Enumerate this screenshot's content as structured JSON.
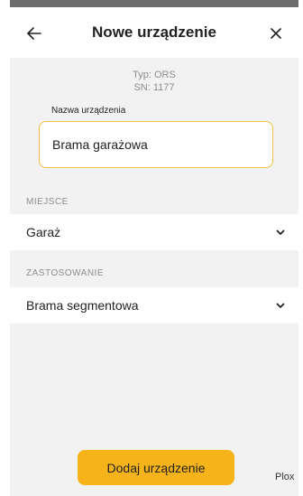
{
  "header": {
    "title": "Nowe urządzenie",
    "back_icon": "arrow-left-icon",
    "close_icon": "close-icon"
  },
  "device": {
    "type_line": "Typ: ORS",
    "sn_line": "SN: 1177"
  },
  "name_field": {
    "label": "Nazwa urządzenia",
    "value": "Brama garażowa"
  },
  "place": {
    "section_label": "MIEJSCE",
    "value": "Garaż",
    "icon": "chevron-down-icon"
  },
  "usage": {
    "section_label": "ZASTOSOWANIE",
    "value": "Brama segmentowa",
    "icon": "chevron-down-icon"
  },
  "actions": {
    "add_label": "Dodaj urządzenie"
  },
  "footer": {
    "brand": "Plox"
  },
  "colors": {
    "accent": "#f6b41a",
    "field_border": "#f4c04a",
    "background": "#f2f2f2"
  }
}
